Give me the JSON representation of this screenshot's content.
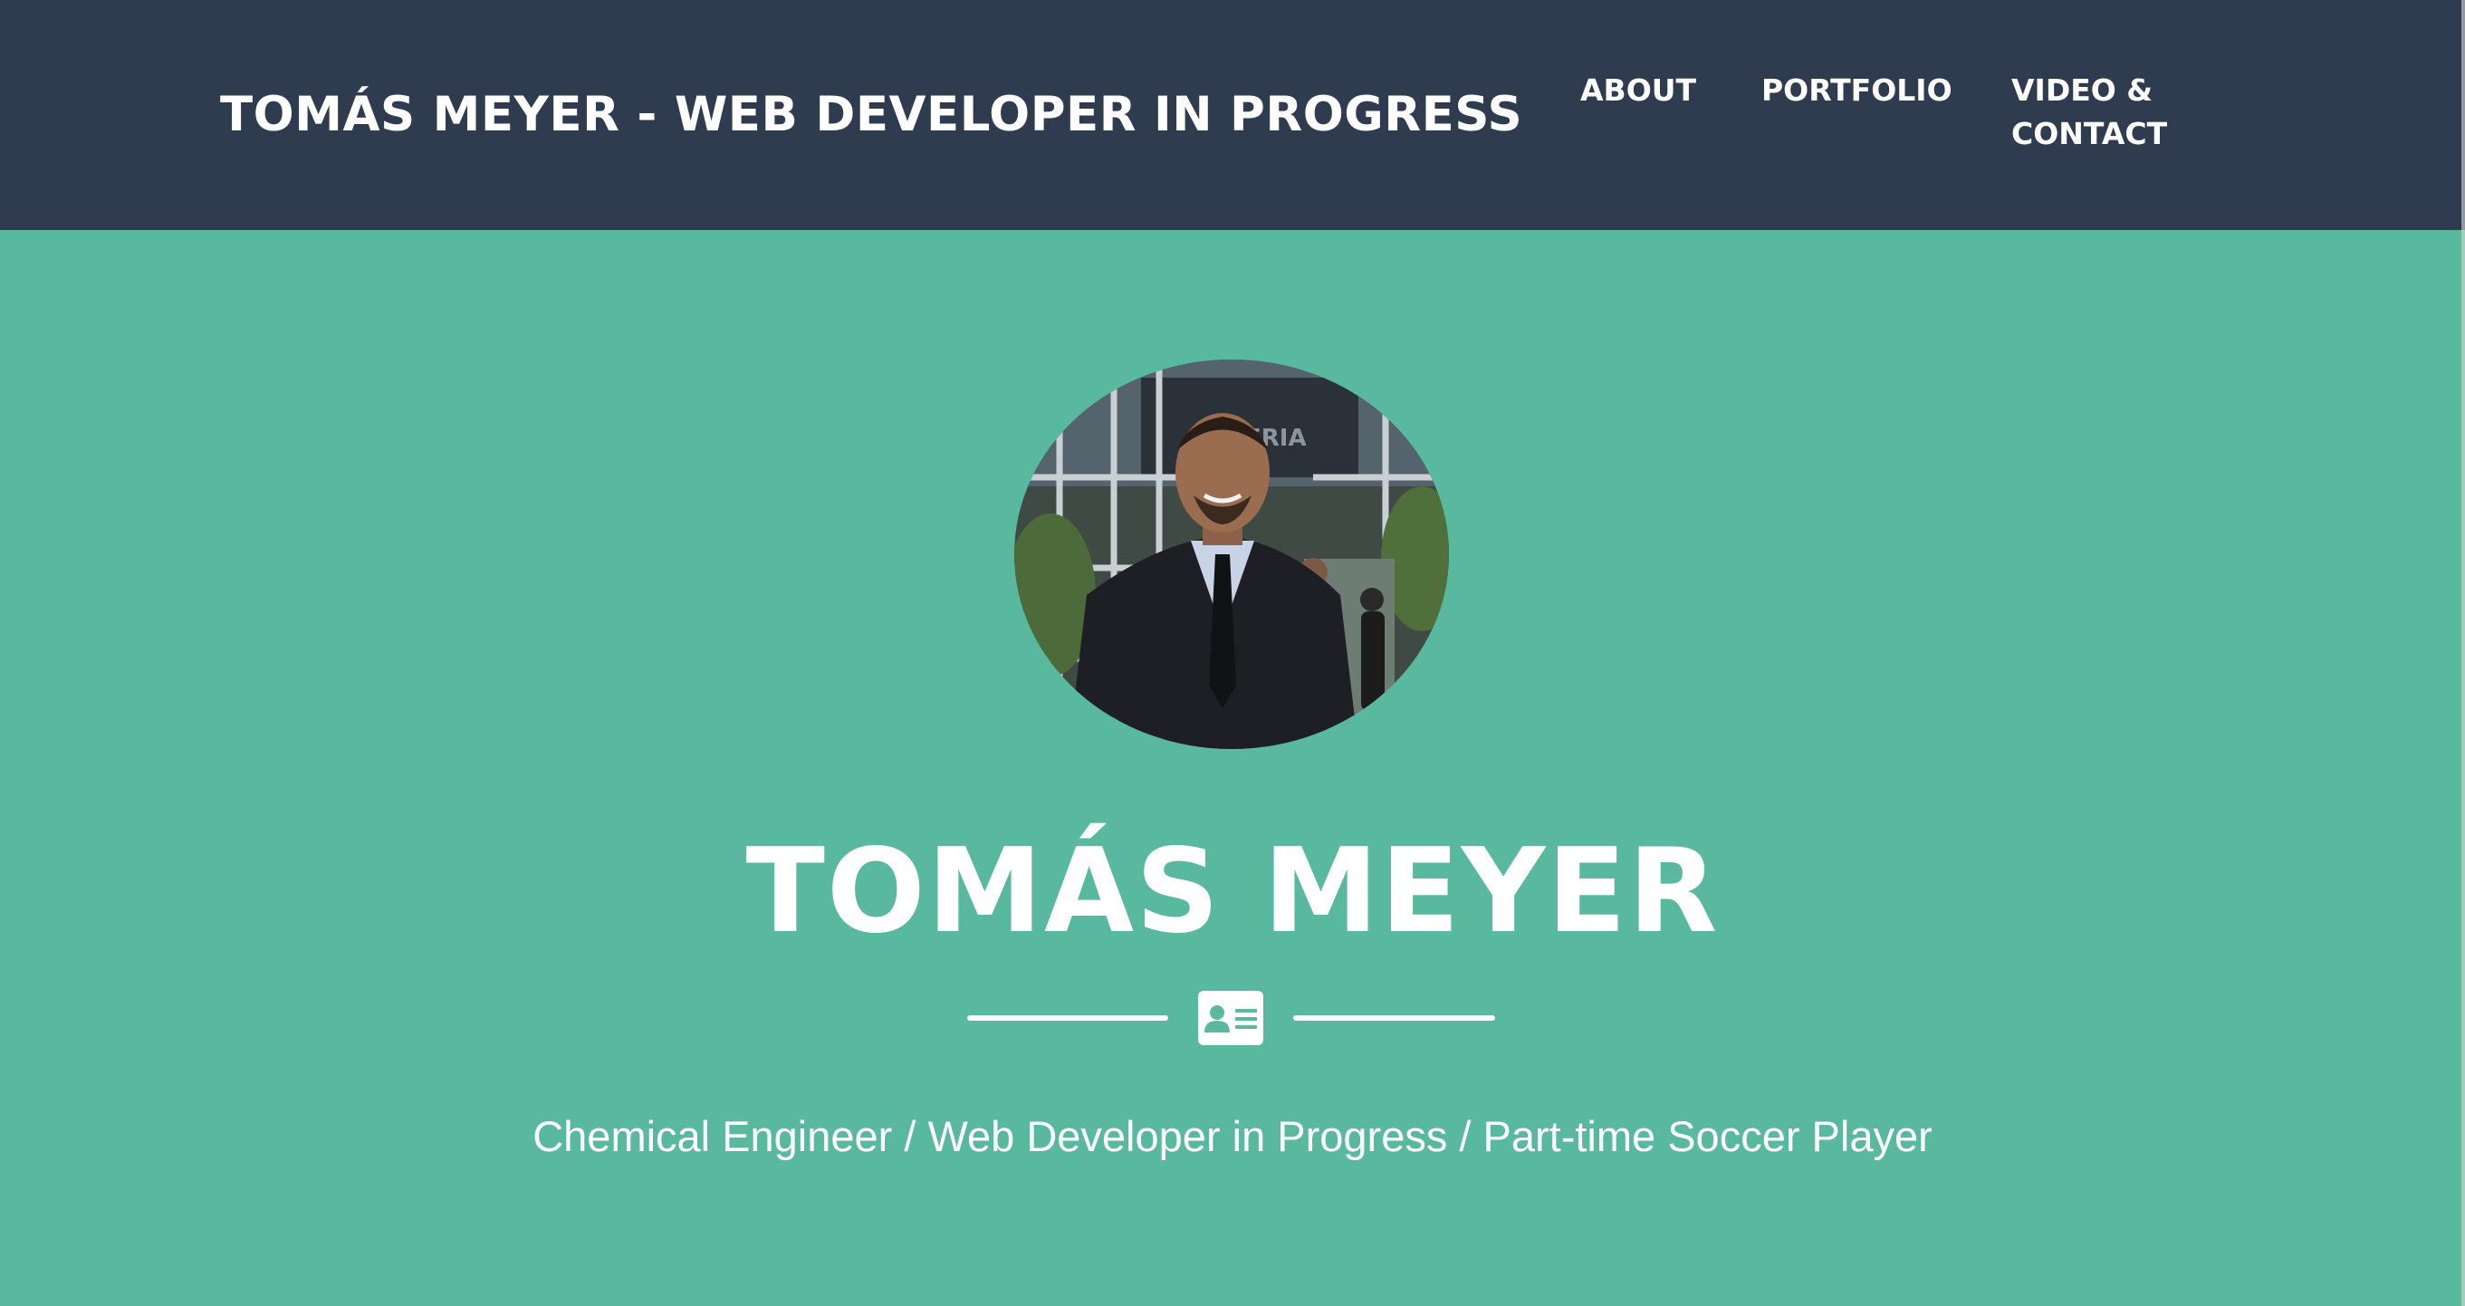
{
  "navbar": {
    "brand": "TOMÁS MEYER - WEB DEVELOPER IN PROGRESS",
    "links": {
      "about": "ABOUT",
      "portfolio": "PORTFOLIO",
      "video_line1": "VIDEO &",
      "video_line2": "CONTACT"
    }
  },
  "hero": {
    "name": "TOMÁS MEYER",
    "divider_icon": "id-card-icon",
    "subtitle": "Chemical Engineer / Web Developer in Progress / Part-time Soccer Player",
    "photo_sign_text": "ERIA"
  },
  "colors": {
    "navbar_bg": "#2f3c50",
    "hero_bg": "#59b99f",
    "text": "#ffffff"
  }
}
